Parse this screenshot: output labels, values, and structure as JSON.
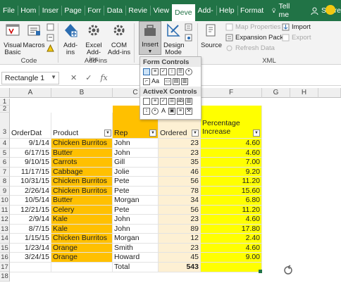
{
  "tabs": [
    "File",
    "Hom",
    "Inser",
    "Page",
    "Forr",
    "Data",
    "Revie",
    "View",
    "Deve",
    "Add-",
    "Help",
    "Format"
  ],
  "active_tab": "Deve",
  "tell_me": "Tell me",
  "share": "Share",
  "ribbon": {
    "code": {
      "visual_basic": "Visual Basic",
      "macros": "Macros",
      "label": "Code"
    },
    "addins": {
      "addins": "Add-ins",
      "excel_addins": "Excel Add-ins",
      "com_addins": "COM Add-ins",
      "label": "Add-ins"
    },
    "controls": {
      "insert": "Insert",
      "design_mode": "Design Mode"
    },
    "xml": {
      "source": "Source",
      "map_properties": "Map Properties",
      "expansion_packs": "Expansion Packs",
      "refresh_data": "Refresh Data",
      "import": "Import",
      "export": "Export",
      "label": "XML"
    }
  },
  "insert_panel": {
    "form_controls": "Form Controls",
    "activex_controls": "ActiveX Controls"
  },
  "namebox": "Rectangle 1",
  "fx": "fx",
  "columns": [
    "A",
    "B",
    "C",
    "D",
    "E",
    "F",
    "G",
    "H"
  ],
  "headers": {
    "order_date": "OrderDat",
    "product": "Product",
    "rep": "Rep",
    "ordered": "Ordered",
    "pct_line1": "Percentage",
    "pct_line2": "Increase"
  },
  "rows": [
    {
      "date": "9/1/14",
      "product": "Chicken Burritos",
      "rep": "John",
      "ordered": "23",
      "pct": "4.60"
    },
    {
      "date": "6/17/15",
      "product": "Butter",
      "rep": "John",
      "ordered": "23",
      "pct": "4.60"
    },
    {
      "date": "9/10/15",
      "product": "Carrots",
      "rep": "Gill",
      "ordered": "35",
      "pct": "7.00"
    },
    {
      "date": "11/17/15",
      "product": "Cabbage",
      "rep": "Jolie",
      "ordered": "46",
      "pct": "9.20"
    },
    {
      "date": "10/31/15",
      "product": "Chicken Burritos",
      "rep": "Pete",
      "ordered": "56",
      "pct": "11.20"
    },
    {
      "date": "2/26/14",
      "product": "Chicken Burritos",
      "rep": "Pete",
      "ordered": "78",
      "pct": "15.60"
    },
    {
      "date": "10/5/14",
      "product": "Butter",
      "rep": "Morgan",
      "ordered": "34",
      "pct": "6.80"
    },
    {
      "date": "12/21/15",
      "product": "Celery",
      "rep": "Pete",
      "ordered": "56",
      "pct": "11.20"
    },
    {
      "date": "2/9/14",
      "product": "Kale",
      "rep": "John",
      "ordered": "23",
      "pct": "4.60"
    },
    {
      "date": "8/7/15",
      "product": "Kale",
      "rep": "John",
      "ordered": "89",
      "pct": "17.80"
    },
    {
      "date": "1/15/15",
      "product": "Chicken Burritos",
      "rep": "Morgan",
      "ordered": "12",
      "pct": "2.40"
    },
    {
      "date": "1/23/14",
      "product": "Orange",
      "rep": "Smith",
      "ordered": "23",
      "pct": "4.60"
    },
    {
      "date": "3/24/15",
      "product": "Orange",
      "rep": "Howard",
      "ordered": "45",
      "pct": "9.00"
    }
  ],
  "total": {
    "label": "Total",
    "value": "543"
  },
  "row_numbers": [
    "1",
    "2",
    "3",
    "4",
    "5",
    "6",
    "7",
    "8",
    "9",
    "10",
    "11",
    "12",
    "13",
    "14",
    "15",
    "16",
    "17",
    "18"
  ],
  "colors": {
    "excel_green": "#217346",
    "orange": "#ffc000",
    "yellow": "#ffff00",
    "cream": "#fdf0d3"
  }
}
